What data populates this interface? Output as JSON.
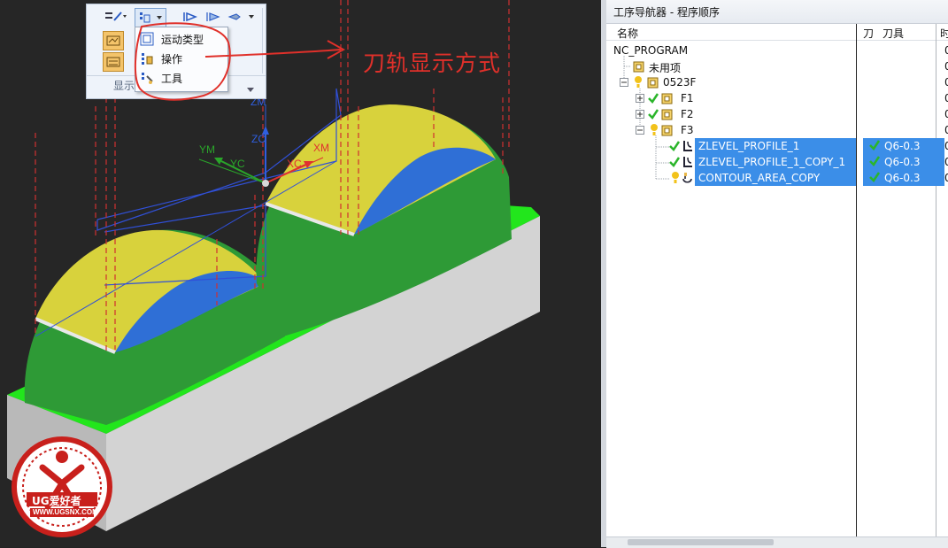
{
  "toolbar": {
    "group_label": "显示",
    "dropdown_items": [
      {
        "label": "运动类型",
        "icon": "motion-type-icon"
      },
      {
        "label": "操作",
        "icon": "operation-icon"
      },
      {
        "label": "工具",
        "icon": "tool-icon"
      }
    ]
  },
  "annotation": {
    "text": "刀轨显示方式",
    "color": "#e0302a"
  },
  "axes": {
    "zm": "ZM",
    "zc": "ZC",
    "ym": "YM",
    "yc": "YC",
    "xm": "XM",
    "xc": "XC"
  },
  "watermark": {
    "brand": "UG爱好者",
    "url": "WWW.UGSNX.COM"
  },
  "navigator": {
    "title": "工序导航器 - 程序顺序",
    "columns": {
      "name": "名称",
      "col2": "刀",
      "tool": "刀具",
      "col4": "时"
    },
    "rows": [
      {
        "label": "NC_PROGRAM",
        "tail": "0"
      },
      {
        "label": "未用项",
        "tail": "0"
      },
      {
        "label": "0523F",
        "tail": "0"
      },
      {
        "label": "F1",
        "tail": "0"
      },
      {
        "label": "F2",
        "tail": "0"
      },
      {
        "label": "F3",
        "tail": "0"
      },
      {
        "label": "ZLEVEL_PROFILE_1",
        "tool": "Q6-0.3",
        "tail": "0"
      },
      {
        "label": "ZLEVEL_PROFILE_1_COPY_1",
        "tool": "Q6-0.3",
        "tail": "0"
      },
      {
        "label": "CONTOUR_AREA_COPY",
        "tool": "Q6-0.3",
        "tail": "0"
      }
    ]
  },
  "colors": {
    "selection": "#3b8ee8",
    "check": "#2bb52b",
    "part_yellow": "#d8d23c",
    "part_green": "#2e9a36",
    "part_blue": "#2f6fd6",
    "base_green": "#22e61c"
  }
}
